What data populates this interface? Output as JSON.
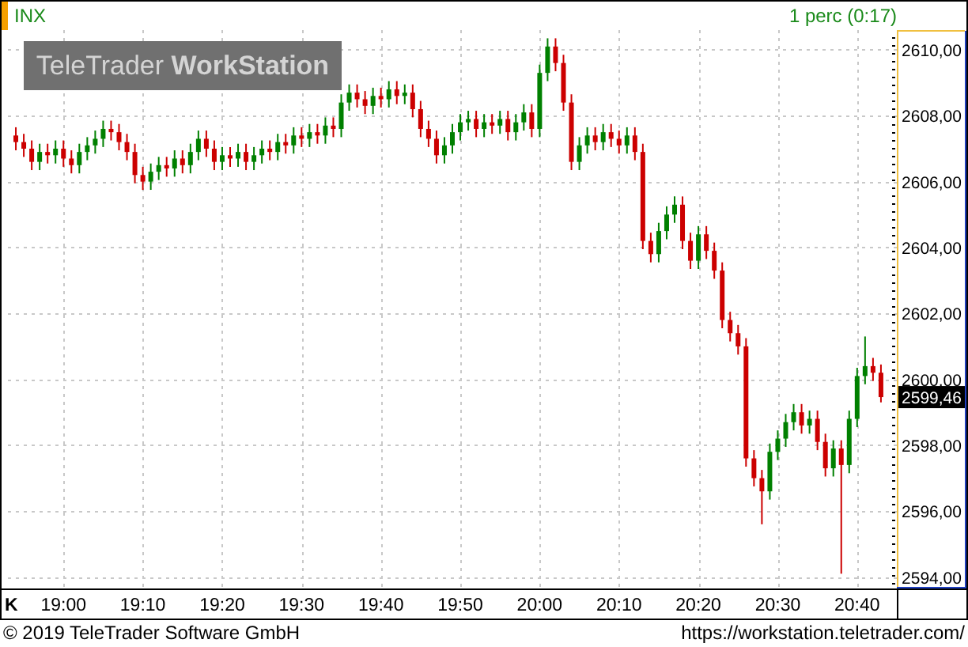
{
  "header": {
    "symbol": "INX",
    "interval": "1 perc (0:17)"
  },
  "watermark": "TeleTrader **WorkStation**",
  "chart": {
    "last_price": "2599,46",
    "axis_mark": "K",
    "chart_data": {
      "type": "candlestick",
      "categories": [
        null,
        null,
        null,
        null,
        null,
        null,
        "19:00",
        null,
        null,
        null,
        null,
        null,
        null,
        null,
        null,
        null,
        "19:10",
        null,
        null,
        null,
        null,
        null,
        null,
        null,
        null,
        null,
        "19:20",
        null,
        null,
        null,
        null,
        null,
        null,
        null,
        null,
        null,
        "19:30",
        null,
        null,
        null,
        null,
        null,
        null,
        null,
        null,
        null,
        "19:40",
        null,
        null,
        null,
        null,
        null,
        null,
        null,
        null,
        null,
        "19:50",
        null,
        null,
        null,
        null,
        null,
        null,
        null,
        null,
        null,
        "20:00",
        null,
        null,
        null,
        null,
        null,
        null,
        null,
        null,
        null,
        "20:10",
        null,
        null,
        null,
        null,
        null,
        null,
        null,
        null,
        null,
        "20:20",
        null,
        null,
        null,
        null,
        null,
        null,
        null,
        null,
        null,
        "20:30",
        null,
        null,
        null,
        null,
        null,
        null,
        null,
        null,
        null,
        "20:40",
        null,
        null,
        null
      ],
      "ohlc": [
        [
          2607.4,
          2607.65,
          2606.95,
          2607.2
        ],
        [
          2607.2,
          2607.45,
          2606.75,
          2607.0
        ],
        [
          2607.0,
          2607.25,
          2606.35,
          2606.6
        ],
        [
          2606.6,
          2607.15,
          2606.35,
          2606.9
        ],
        [
          2606.9,
          2607.15,
          2606.55,
          2606.8
        ],
        [
          2606.8,
          2607.25,
          2606.55,
          2607.0
        ],
        [
          2607.0,
          2607.25,
          2606.45,
          2606.7
        ],
        [
          2606.7,
          2606.95,
          2606.25,
          2606.5
        ],
        [
          2606.5,
          2607.15,
          2606.25,
          2606.9
        ],
        [
          2606.9,
          2607.35,
          2606.65,
          2607.1
        ],
        [
          2607.1,
          2607.55,
          2606.85,
          2607.3
        ],
        [
          2607.3,
          2607.85,
          2607.05,
          2607.6
        ],
        [
          2607.6,
          2607.85,
          2607.25,
          2607.5
        ],
        [
          2607.5,
          2607.75,
          2606.95,
          2607.2
        ],
        [
          2607.2,
          2607.45,
          2606.65,
          2606.9
        ],
        [
          2606.9,
          2607.15,
          2605.95,
          2606.2
        ],
        [
          2606.2,
          2606.45,
          2605.75,
          2606.0
        ],
        [
          2606.0,
          2606.55,
          2605.75,
          2606.3
        ],
        [
          2606.3,
          2606.75,
          2606.05,
          2606.5
        ],
        [
          2606.5,
          2606.75,
          2606.15,
          2606.4
        ],
        [
          2606.4,
          2606.95,
          2606.15,
          2606.7
        ],
        [
          2606.7,
          2606.95,
          2606.25,
          2606.5
        ],
        [
          2606.5,
          2607.15,
          2606.25,
          2606.9
        ],
        [
          2606.9,
          2607.55,
          2606.65,
          2607.3
        ],
        [
          2607.3,
          2607.55,
          2606.75,
          2607.0
        ],
        [
          2607.0,
          2607.25,
          2606.35,
          2606.6
        ],
        [
          2606.6,
          2607.05,
          2606.35,
          2606.8
        ],
        [
          2606.8,
          2607.05,
          2606.45,
          2606.7
        ],
        [
          2606.7,
          2607.15,
          2606.45,
          2606.9
        ],
        [
          2606.9,
          2607.15,
          2606.35,
          2606.6
        ],
        [
          2606.6,
          2607.05,
          2606.35,
          2606.8
        ],
        [
          2606.8,
          2607.25,
          2606.55,
          2607.0
        ],
        [
          2607.0,
          2607.25,
          2606.65,
          2606.9
        ],
        [
          2606.9,
          2607.45,
          2606.65,
          2607.2
        ],
        [
          2607.2,
          2607.45,
          2606.85,
          2607.1
        ],
        [
          2607.1,
          2607.65,
          2606.85,
          2607.4
        ],
        [
          2607.4,
          2607.65,
          2607.05,
          2607.3
        ],
        [
          2607.3,
          2607.75,
          2607.05,
          2607.5
        ],
        [
          2607.5,
          2607.75,
          2607.15,
          2607.4
        ],
        [
          2607.4,
          2607.95,
          2607.15,
          2607.7
        ],
        [
          2607.7,
          2607.95,
          2607.35,
          2607.6
        ],
        [
          2607.6,
          2608.65,
          2607.35,
          2608.4
        ],
        [
          2608.4,
          2608.95,
          2608.15,
          2608.7
        ],
        [
          2608.7,
          2608.95,
          2608.25,
          2608.5
        ],
        [
          2608.5,
          2608.75,
          2608.05,
          2608.3
        ],
        [
          2608.3,
          2608.85,
          2608.05,
          2608.6
        ],
        [
          2608.6,
          2608.85,
          2608.25,
          2608.5
        ],
        [
          2608.5,
          2609.05,
          2608.25,
          2608.8
        ],
        [
          2608.8,
          2609.05,
          2608.35,
          2608.6
        ],
        [
          2608.6,
          2608.95,
          2608.35,
          2608.7
        ],
        [
          2608.7,
          2608.95,
          2607.95,
          2608.2
        ],
        [
          2608.2,
          2608.45,
          2607.35,
          2607.6
        ],
        [
          2607.6,
          2607.85,
          2607.05,
          2607.3
        ],
        [
          2607.3,
          2607.55,
          2606.55,
          2606.8
        ],
        [
          2606.8,
          2607.35,
          2606.55,
          2607.1
        ],
        [
          2607.1,
          2607.75,
          2606.85,
          2607.5
        ],
        [
          2607.5,
          2608.05,
          2607.25,
          2607.8
        ],
        [
          2607.8,
          2608.15,
          2607.55,
          2607.9
        ],
        [
          2607.9,
          2608.15,
          2607.35,
          2607.6
        ],
        [
          2607.6,
          2608.05,
          2607.35,
          2607.8
        ],
        [
          2607.8,
          2608.05,
          2607.45,
          2607.7
        ],
        [
          2607.7,
          2608.15,
          2607.45,
          2607.9
        ],
        [
          2607.9,
          2608.15,
          2607.25,
          2607.5
        ],
        [
          2607.5,
          2608.05,
          2607.25,
          2607.8
        ],
        [
          2607.8,
          2608.35,
          2607.55,
          2608.1
        ],
        [
          2608.1,
          2608.35,
          2607.35,
          2607.6
        ],
        [
          2607.6,
          2609.55,
          2607.35,
          2609.3
        ],
        [
          2609.3,
          2610.35,
          2609.05,
          2610.1
        ],
        [
          2610.1,
          2610.35,
          2609.35,
          2609.6
        ],
        [
          2609.6,
          2609.85,
          2608.15,
          2608.4
        ],
        [
          2608.4,
          2608.65,
          2606.35,
          2606.6
        ],
        [
          2606.6,
          2607.35,
          2606.35,
          2607.1
        ],
        [
          2607.1,
          2607.65,
          2606.85,
          2607.4
        ],
        [
          2607.4,
          2607.65,
          2606.95,
          2607.2
        ],
        [
          2607.2,
          2607.75,
          2606.95,
          2607.5
        ],
        [
          2607.5,
          2607.75,
          2607.05,
          2607.3
        ],
        [
          2607.3,
          2607.55,
          2606.85,
          2607.1
        ],
        [
          2607.1,
          2607.65,
          2606.85,
          2607.4
        ],
        [
          2607.4,
          2607.65,
          2606.65,
          2606.9
        ],
        [
          2606.9,
          2607.15,
          2603.95,
          2604.2
        ],
        [
          2604.2,
          2604.45,
          2603.55,
          2603.8
        ],
        [
          2603.8,
          2604.75,
          2603.55,
          2604.5
        ],
        [
          2604.5,
          2605.25,
          2604.25,
          2605.0
        ],
        [
          2605.0,
          2605.55,
          2604.75,
          2605.3
        ],
        [
          2605.3,
          2605.55,
          2603.95,
          2604.2
        ],
        [
          2604.2,
          2604.45,
          2603.35,
          2603.6
        ],
        [
          2603.6,
          2604.65,
          2603.35,
          2604.4
        ],
        [
          2604.4,
          2604.65,
          2603.65,
          2603.9
        ],
        [
          2603.9,
          2604.15,
          2603.05,
          2603.3
        ],
        [
          2603.3,
          2603.55,
          2601.55,
          2601.8
        ],
        [
          2601.8,
          2602.05,
          2601.15,
          2601.4
        ],
        [
          2601.4,
          2601.65,
          2600.75,
          2601.0
        ],
        [
          2601.0,
          2601.25,
          2597.35,
          2597.6
        ],
        [
          2597.6,
          2597.85,
          2596.75,
          2597.0
        ],
        [
          2597.0,
          2597.25,
          2595.6,
          2596.6
        ],
        [
          2596.6,
          2598.05,
          2596.35,
          2597.8
        ],
        [
          2597.8,
          2598.45,
          2597.55,
          2598.2
        ],
        [
          2598.2,
          2598.95,
          2597.95,
          2598.7
        ],
        [
          2598.7,
          2599.25,
          2598.45,
          2599.0
        ],
        [
          2599.0,
          2599.25,
          2598.35,
          2598.6
        ],
        [
          2598.6,
          2599.05,
          2598.35,
          2598.8
        ],
        [
          2598.8,
          2599.05,
          2597.85,
          2598.1
        ],
        [
          2598.1,
          2598.35,
          2597.05,
          2597.3
        ],
        [
          2597.3,
          2598.15,
          2597.05,
          2597.9
        ],
        [
          2597.9,
          2598.15,
          2594.1,
          2597.4
        ],
        [
          2597.4,
          2599.05,
          2597.15,
          2598.8
        ],
        [
          2598.8,
          2600.35,
          2598.55,
          2600.1
        ],
        [
          2600.1,
          2601.3,
          2599.85,
          2600.4
        ],
        [
          2600.4,
          2600.65,
          2599.95,
          2600.2
        ],
        [
          2600.2,
          2600.45,
          2599.3,
          2599.46
        ]
      ],
      "ylim": [
        2593.7,
        2610.6
      ],
      "grid": true,
      "yticks": [
        {
          "value": 2594,
          "label": "2594,00"
        },
        {
          "value": 2596,
          "label": "2596,00"
        },
        {
          "value": 2598,
          "label": "2598,00"
        },
        {
          "value": 2600,
          "label": "2600,00"
        },
        {
          "value": 2602,
          "label": "2602,00"
        },
        {
          "value": 2604,
          "label": "2604,00"
        },
        {
          "value": 2606,
          "label": "2606,00"
        },
        {
          "value": 2608,
          "label": "2608,00"
        },
        {
          "value": 2610,
          "label": "2610,00"
        }
      ]
    }
  },
  "footer": {
    "copyright": "© 2019 TeleTrader Software GmbH",
    "url": "https://workstation.teletrader.com/"
  }
}
